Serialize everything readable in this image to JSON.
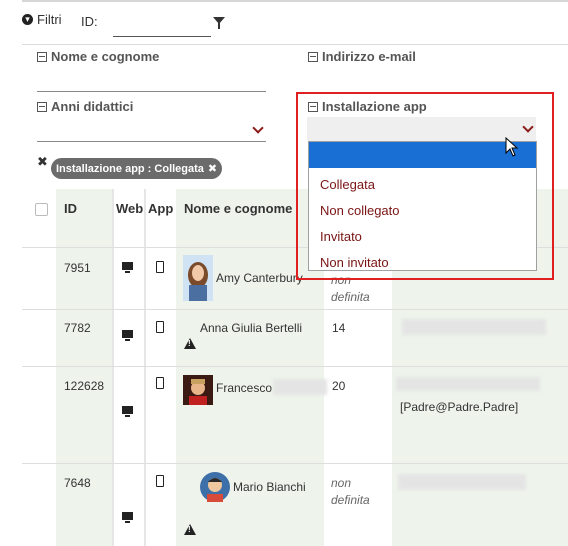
{
  "filters": {
    "toggle_label": "Filtri",
    "id_label": "ID:",
    "id_value": "",
    "nome_label": "Nome e cognome",
    "email_label": "Indirizzo e-mail",
    "anni_label": "Anni didattici",
    "app_label": "Installazione app",
    "app_options": [
      "Collegata",
      "Non collegato",
      "Invitato",
      "Non invitato"
    ],
    "active_chip": "Installazione app : Collegata"
  },
  "table": {
    "headers": {
      "id": "ID",
      "web": "Web",
      "app": "App",
      "name": "Nome e cognome"
    },
    "rows": [
      {
        "id": "7951",
        "name": "Amy Canterbury",
        "col4": "non definita",
        "warning": false
      },
      {
        "id": "7782",
        "name": "Anna Giulia Bertelli",
        "col4": "14",
        "warning": true
      },
      {
        "id": "122628",
        "name": "Francesco",
        "col4": "20",
        "email": "[Padre@Padre.Padre]",
        "warning": false
      },
      {
        "id": "7648",
        "name": "Mario Bianchi",
        "col4": "non definita",
        "warning": true
      }
    ]
  },
  "colors": {
    "accent": "#8b1a1a",
    "highlight": "#e02020",
    "selected": "#1a6fd4"
  }
}
